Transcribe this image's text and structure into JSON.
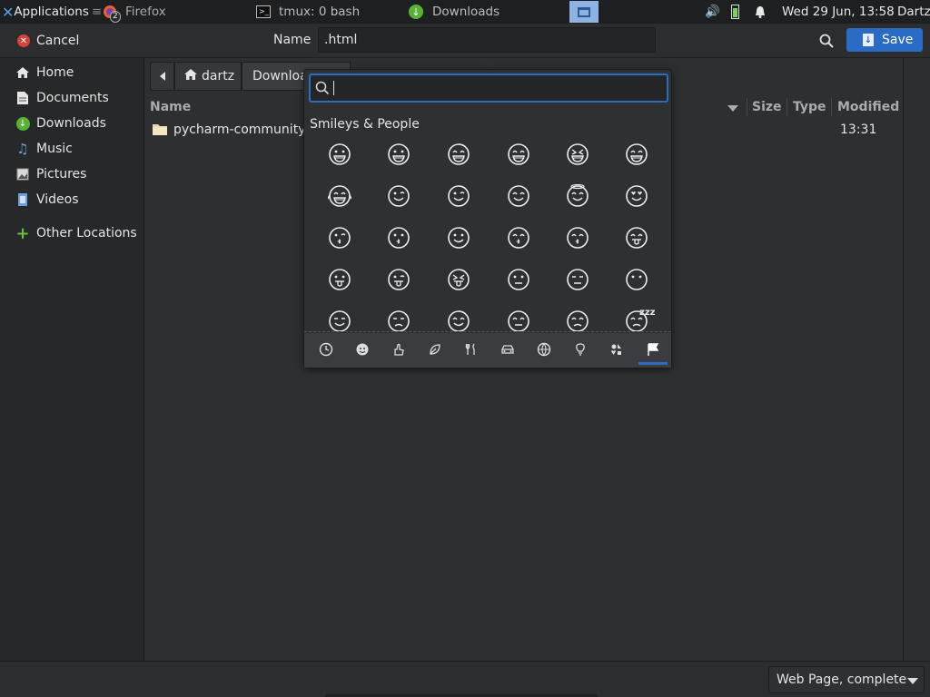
{
  "panel": {
    "applications": "Applications",
    "firefox": "Firefox",
    "firefox_badge": "2",
    "tmux": "tmux: 0 bash",
    "downloads": "Downloads",
    "datetime": "Wed 29 Jun, 13:58",
    "user": "Dartz"
  },
  "header": {
    "cancel": "Cancel",
    "name_label": "Name",
    "name_value": ".html",
    "save": "Save"
  },
  "sidebar": {
    "items": [
      {
        "label": "Home"
      },
      {
        "label": "Documents"
      },
      {
        "label": "Downloads"
      },
      {
        "label": "Music"
      },
      {
        "label": "Pictures"
      },
      {
        "label": "Videos"
      },
      {
        "label": "Other Locations"
      }
    ]
  },
  "path": {
    "home": "dartz",
    "current": "Downloa"
  },
  "columns": {
    "name": "Name",
    "size": "Size",
    "type": "Type",
    "modified": "Modified"
  },
  "files": [
    {
      "name": "pycharm-community-",
      "modified": "13:31"
    }
  ],
  "emoji": {
    "section": "Smileys & People",
    "search_value": "",
    "rows": [
      [
        "😀",
        "😃",
        "😄",
        "😁",
        "😆",
        "😅"
      ],
      [
        "🤣",
        "🙃",
        "😉",
        "😊",
        "😇",
        "😍"
      ],
      [
        "😘",
        "😗",
        "🙂",
        "😚",
        "😙",
        "😋"
      ],
      [
        "😛",
        "😜",
        "😝",
        "😐",
        "😑",
        "😶"
      ],
      [
        "😏",
        "😒",
        "😌",
        "😔",
        "😪",
        "😴"
      ]
    ],
    "categories": [
      "recent-icon",
      "smileys-icon",
      "body-icon",
      "nature-icon",
      "food-icon",
      "travel-icon",
      "activities-icon",
      "objects-icon",
      "symbols-icon",
      "flags-icon"
    ],
    "selected_category": "flags-icon",
    "sleep_mark": "zzz"
  },
  "filetype": "Web Page, complete",
  "colors": {
    "accent": "#2a6cc4",
    "downloads": "#59b235",
    "other_plus": "#6ec03c"
  }
}
